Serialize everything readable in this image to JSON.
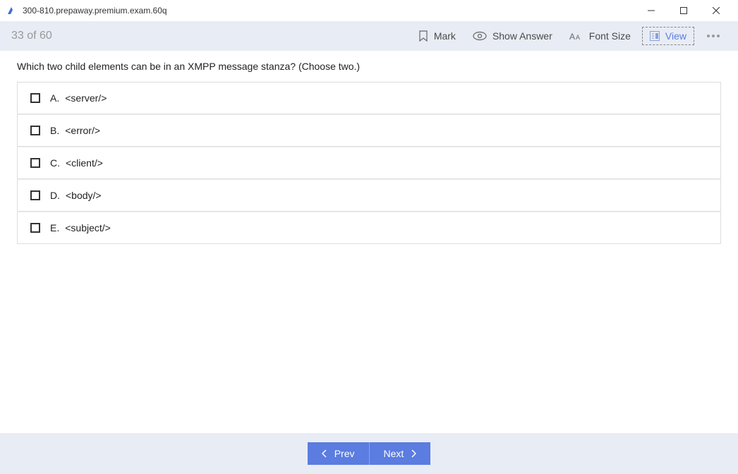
{
  "window": {
    "title": "300-810.prepaway.premium.exam.60q"
  },
  "toolbar": {
    "progress": "33 of 60",
    "mark_label": "Mark",
    "show_answer_label": "Show Answer",
    "font_size_label": "Font Size",
    "view_label": "View"
  },
  "question": {
    "text": "Which two child elements can be in an XMPP message stanza? (Choose two.)",
    "options": [
      {
        "letter": "A.",
        "text": "<server/>"
      },
      {
        "letter": "B.",
        "text": "<error/>"
      },
      {
        "letter": "C.",
        "text": "<client/>"
      },
      {
        "letter": "D.",
        "text": "<body/>"
      },
      {
        "letter": "E.",
        "text": "<subject/>"
      }
    ]
  },
  "footer": {
    "prev_label": "Prev",
    "next_label": "Next"
  }
}
